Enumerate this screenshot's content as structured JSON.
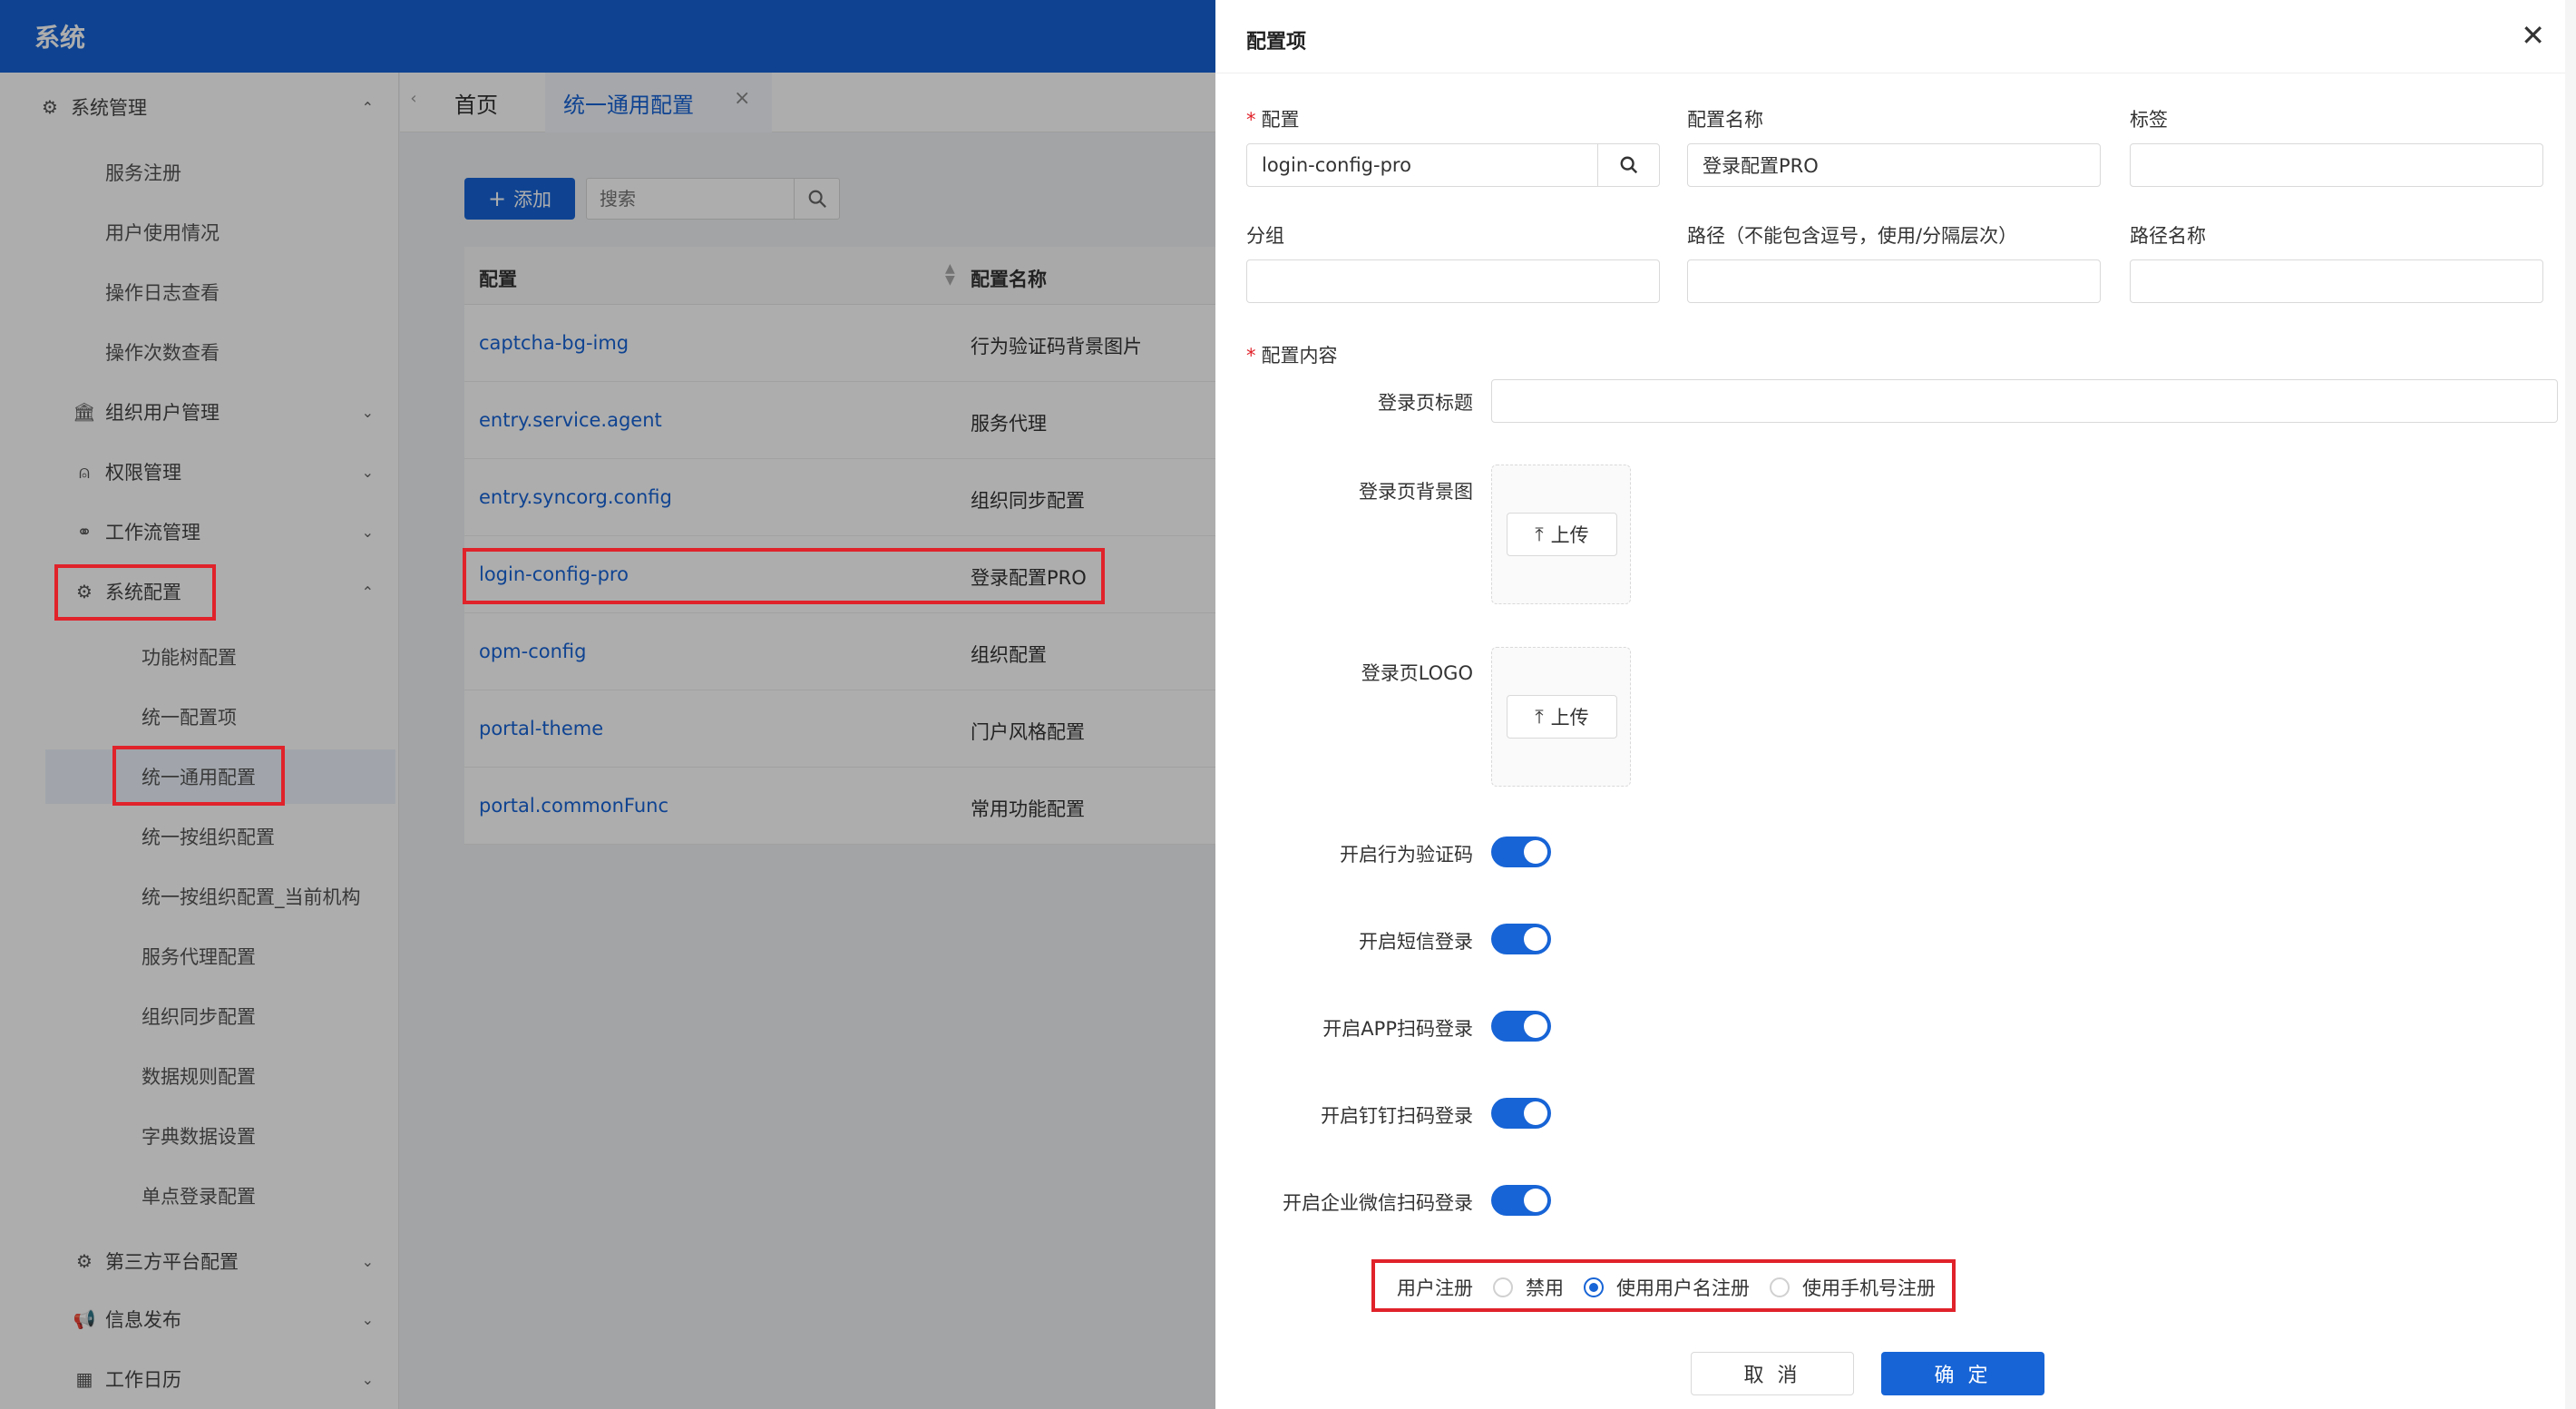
{
  "app": {
    "title": "系统"
  },
  "sidebar": {
    "items": [
      {
        "label": "系统管理",
        "icon": "gear-icon",
        "arrow": "⌃"
      },
      {
        "label": "服务注册"
      },
      {
        "label": "用户使用情况"
      },
      {
        "label": "操作日志查看"
      },
      {
        "label": "操作次数查看"
      },
      {
        "label": "组织用户管理",
        "icon": "bank-icon",
        "arrow": "⌄"
      },
      {
        "label": "权限管理",
        "icon": "user-icon",
        "arrow": "⌄"
      },
      {
        "label": "工作流管理",
        "icon": "workflow-icon",
        "arrow": "⌄"
      },
      {
        "label": "系统配置",
        "icon": "gear-icon",
        "arrow": "⌃"
      },
      {
        "label": "功能树配置"
      },
      {
        "label": "统一配置项"
      },
      {
        "label": "统一通用配置"
      },
      {
        "label": "统一按组织配置"
      },
      {
        "label": "统一按组织配置_当前机构"
      },
      {
        "label": "服务代理配置"
      },
      {
        "label": "组织同步配置"
      },
      {
        "label": "数据规则配置"
      },
      {
        "label": "字典数据设置"
      },
      {
        "label": "单点登录配置"
      },
      {
        "label": "第三方平台配置",
        "icon": "gear-icon",
        "arrow": "⌄"
      },
      {
        "label": "信息发布",
        "icon": "megaphone-icon",
        "arrow": "⌄"
      },
      {
        "label": "工作日历",
        "icon": "calendar-icon",
        "arrow": "⌄"
      }
    ]
  },
  "tabs": {
    "home": "首页",
    "current": "统一通用配置",
    "close": "×",
    "prev": "‹"
  },
  "toolbar": {
    "add_label": "添加",
    "add_icon": "+",
    "search_placeholder": "搜索"
  },
  "table": {
    "columns": [
      "配置",
      "配置名称"
    ],
    "rows": [
      {
        "key": "captcha-bg-img",
        "name": "行为验证码背景图片"
      },
      {
        "key": "entry.service.agent",
        "name": "服务代理"
      },
      {
        "key": "entry.syncorg.config",
        "name": "组织同步配置"
      },
      {
        "key": "login-config-pro",
        "name": "登录配置PRO"
      },
      {
        "key": "opm-config",
        "name": "组织配置"
      },
      {
        "key": "portal-theme",
        "name": "门户风格配置"
      },
      {
        "key": "portal.commonFunc",
        "name": "常用功能配置"
      }
    ]
  },
  "drawer": {
    "title": "配置项",
    "close": "✕",
    "fields": {
      "config_label": "配置",
      "config_value": "login-config-pro",
      "config_name_label": "配置名称",
      "config_name_value": "登录配置PRO",
      "tag_label": "标签",
      "group_label": "分组",
      "path_label": "路径（不能包含逗号，使用/分隔层次）",
      "path_name_label": "路径名称",
      "content_label": "配置内容",
      "required_mark": "*"
    },
    "content": {
      "login_title_label": "登录页标题",
      "login_bg_label": "登录页背景图",
      "login_logo_label": "登录页LOGO",
      "upload_label": "上传",
      "upload_icon": "⤒",
      "switches": [
        {
          "label": "开启行为验证码",
          "on": true
        },
        {
          "label": "开启短信登录",
          "on": true
        },
        {
          "label": "开启APP扫码登录",
          "on": true
        },
        {
          "label": "开启钉钉扫码登录",
          "on": true
        },
        {
          "label": "开启企业微信扫码登录",
          "on": true
        }
      ],
      "register": {
        "label": "用户注册",
        "options": [
          "禁用",
          "使用用户名注册",
          "使用手机号注册"
        ],
        "selected": "使用用户名注册"
      }
    },
    "cancel_label": "取 消",
    "ok_label": "确 定"
  },
  "colors": {
    "primary": "#1764d6",
    "highlight": "#e0222a"
  }
}
